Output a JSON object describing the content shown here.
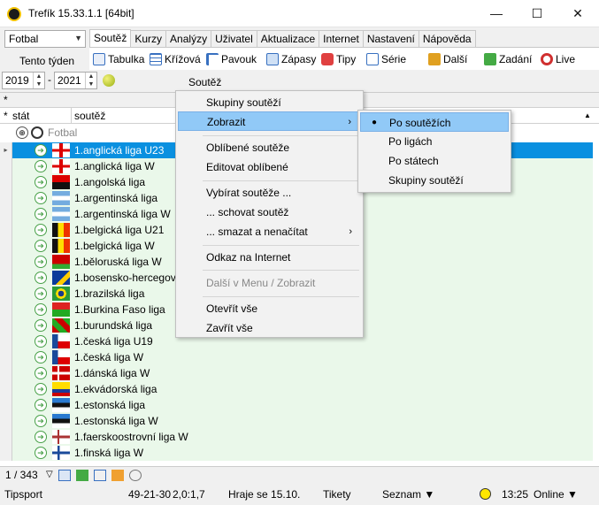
{
  "window": {
    "title": "Trefík 15.33.1.1 [64bit]"
  },
  "sport_select": "Fotbal",
  "period_label": "Tento týden",
  "tabs": [
    "Soutěž",
    "Kurzy",
    "Analýzy",
    "Uživatel",
    "Aktualizace",
    "Internet",
    "Nastavení",
    "Nápověda"
  ],
  "toolbar": [
    "Tabulka",
    "Křížová",
    "Pavouk",
    "Zápasy",
    "Tipy",
    "Série",
    "Další",
    "Zadání",
    "Live"
  ],
  "year_from": "2019",
  "year_to": "2021",
  "dash": "-",
  "grid_header": {
    "label": "Soutěž",
    "col_state": "stát",
    "col_comp": "soutěž",
    "star": "*"
  },
  "group": "Fotbal",
  "rows": [
    "1.anglická liga U23",
    "1.anglická liga W",
    "1.angolská liga",
    "1.argentinská liga",
    "1.argentinská liga W",
    "1.belgická liga U21",
    "1.belgická liga W",
    "1.běloruská liga W",
    "1.bosensko-hercegovinská",
    "1.brazilská liga",
    "1.Burkina Faso liga",
    "1.burundská liga",
    "1.česká liga U19",
    "1.česká liga W",
    "1.dánská liga W",
    "1.ekvádorská liga",
    "1.estonská liga",
    "1.estonská liga W",
    "1.faerskoostrovní liga W",
    "1.finská liga W"
  ],
  "menu": {
    "items": [
      "Skupiny soutěží",
      "Zobrazit",
      "Oblíbené soutěže",
      "Editovat oblíbené",
      "Vybírat soutěže ...",
      "... schovat soutěž",
      "... smazat a nenačítat",
      "Odkaz na Internet",
      "Další v Menu / Zobrazit",
      "Otevřít vše",
      "Zavřít vše"
    ]
  },
  "submenu": {
    "items": [
      "Po soutěžích",
      "Po ligách",
      "Po státech",
      "Skupiny soutěží"
    ]
  },
  "status": {
    "count": "1 / 343",
    "bookmaker": "Tipsport",
    "record": "49-21-30",
    "ratio": "2,0:1,7",
    "plays": "Hraje se 15.10.",
    "tickets": "Tikety",
    "list": "Seznam ▼",
    "time": "13:25",
    "online": "Online ▼"
  },
  "colors": {
    "selection": "#0a90e0",
    "row_bg": "#eaf8ea",
    "menu_highlight": "#91c9f7"
  }
}
